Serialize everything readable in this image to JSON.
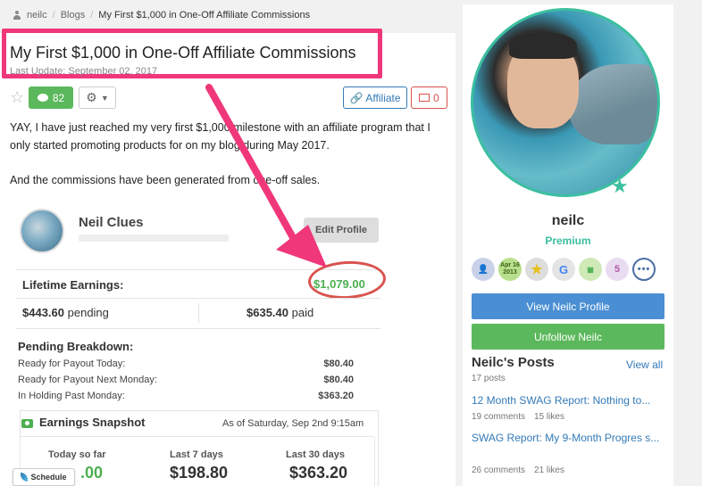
{
  "breadcrumb": {
    "user": "neilc",
    "section": "Blogs",
    "current": "My First $1,000 in One-Off Affiliate Commissions"
  },
  "post": {
    "title": "My First $1,000 in One-Off Affiliate Commissions",
    "last_update": "Last Update: September 02, 2017",
    "comment_count": "82",
    "affiliate_label": "Affiliate",
    "mail_count": "0",
    "paragraph1": "YAY, I have just reached my very first $1,000 milestone with an affiliate program that I only started promoting products for on my blog during May 2017.",
    "paragraph2": "And the commissions have been generated from one-off sales."
  },
  "embed": {
    "name": "Neil Clues",
    "edit_profile": "Edit Profile",
    "lifetime_label": "Lifetime Earnings:",
    "lifetime_value": "$1,079.00",
    "pending_amount": "$443.60",
    "pending_label": "pending",
    "paid_amount": "$635.40",
    "paid_label": "paid",
    "breakdown_title": "Pending Breakdown:",
    "breakdown": [
      {
        "label": "Ready for Payout Today:",
        "amount": "$80.40"
      },
      {
        "label": "Ready for Payout Next Monday:",
        "amount": "$80.40"
      },
      {
        "label": "In Holding Past Monday:",
        "amount": "$363.20"
      }
    ],
    "snapshot_title": "Earnings Snapshot",
    "snapshot_date": "As of Saturday, Sep 2nd 9:15am",
    "stats": [
      {
        "label": "Today so far",
        "value": ".00"
      },
      {
        "label": "Last 7 days",
        "value": "$198.80"
      },
      {
        "label": "Last 30 days",
        "value": "$363.20"
      }
    ]
  },
  "schedule_label": "Schedule",
  "sidebar": {
    "username": "neilc",
    "status": "Premium",
    "badge_date": "Apr 16 2013",
    "view_button": "View Neilc Profile",
    "unfollow_button": "Unfollow Neilc",
    "posts_title": "Neilc's Posts",
    "view_all": "View all",
    "posts_count": "17 posts",
    "posts": [
      {
        "title": "12 Month SWAG Report: Nothing to...",
        "comments": "19 comments",
        "likes": "15 likes"
      },
      {
        "title": "SWAG Report: My 9-Month Progres s...",
        "comments": "26 comments",
        "likes": "21 likes"
      }
    ]
  },
  "colors": {
    "highlight": "#f0377a",
    "accent_green": "#5cb85c",
    "premium": "#3cbfa0",
    "link": "#337ab7"
  }
}
